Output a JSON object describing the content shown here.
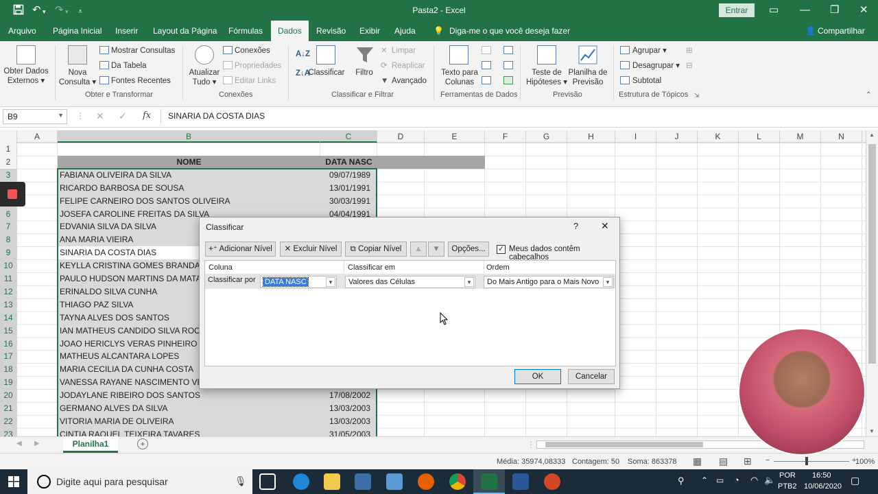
{
  "titlebar": {
    "save_icon": "save-icon",
    "title": "Pasta2  -  Excel",
    "signin": "Entrar"
  },
  "menubar": {
    "tabs": [
      "Arquivo",
      "Página Inicial",
      "Inserir",
      "Layout da Página",
      "Fórmulas",
      "Dados",
      "Revisão",
      "Exibir",
      "Ajuda"
    ],
    "tell_me": "Diga-me o que você deseja fazer",
    "share": "Compartilhar"
  },
  "ribbon": {
    "get_data": {
      "btn1": "Obter Dados",
      "btn1b": "Externos",
      "btn2": "Nova",
      "btn2b": "Consulta",
      "mostrar": "Mostrar Consultas",
      "tabela": "Da Tabela",
      "fontes": "Fontes Recentes",
      "group": "Obter e Transformar"
    },
    "connections": {
      "refresh": "Atualizar",
      "refreshb": "Tudo",
      "conexoes": "Conexões",
      "propriedades": "Propriedades",
      "editar": "Editar Links",
      "group": "Conexões"
    },
    "sort": {
      "classificar": "Classificar",
      "filtro": "Filtro",
      "limpar": "Limpar",
      "reaplicar": "Reaplicar",
      "avancado": "Avançado",
      "group": "Classificar e Filtrar"
    },
    "tools": {
      "texto": "Texto para",
      "textob": "Colunas",
      "group": "Ferramentas de Dados"
    },
    "forecast": {
      "teste": "Teste de",
      "testeb": "Hipóteses",
      "planilha": "Planilha de",
      "planilhab": "Previsão",
      "group": "Previsão"
    },
    "outline": {
      "agrupar": "Agrupar",
      "desagrupar": "Desagrupar",
      "subtotal": "Subtotal",
      "group": "Estrutura de Tópicos"
    }
  },
  "formula_bar": {
    "name_box": "B9",
    "content": "SINARIA DA COSTA DIAS"
  },
  "columns": [
    "A",
    "B",
    "C",
    "D",
    "E",
    "F",
    "G",
    "H",
    "I",
    "J",
    "K",
    "L",
    "M",
    "N"
  ],
  "rows": [
    "1",
    "2",
    "3",
    "4",
    "5",
    "6",
    "7",
    "8",
    "9",
    "10",
    "11",
    "12",
    "13",
    "14",
    "15",
    "16",
    "17",
    "18",
    "19",
    "20",
    "21",
    "22",
    "23"
  ],
  "table": {
    "header_name": "NOME",
    "header_date": "DATA NASC",
    "names": [
      "FABIANA OLIVEIRA DA SILVA",
      "RICARDO BARBOSA DE SOUSA",
      "FELIPE CARNEIRO DOS SANTOS OLIVEIRA",
      "JOSEFA CAROLINE FREITAS DA SILVA",
      "EDVANIA SILVA DA SILVA",
      "ANA MARIA VIEIRA",
      "SINARIA DA COSTA DIAS",
      "KEYLLA CRISTINA GOMES BRANDAO",
      "PAULO HUDSON MARTINS DA MATA",
      "ERINALDO SILVA CUNHA",
      "THIAGO PAZ SILVA",
      "TAYNA ALVES DOS SANTOS",
      "IAN MATHEUS CANDIDO SILVA ROCH",
      "JOAO HERICLYS VERAS PINHEIRO",
      "MATHEUS ALCANTARA LOPES",
      "MARIA CECILIA DA CUNHA COSTA",
      "VANESSA RAYANE NASCIMENTO VE",
      "JODAYLANE RIBEIRO DOS SANTOS",
      "GERMANO ALVES DA SILVA",
      "VITORIA MARIA DE OLIVEIRA",
      "CINTIA RAQUEL TEIXEIRA TAVARES"
    ],
    "dates": [
      "09/07/1989",
      "13/01/1991",
      "30/03/1991",
      "04/04/1991",
      "",
      "",
      "",
      "",
      "",
      "",
      "",
      "",
      "",
      "",
      "",
      "",
      "",
      "17/08/2002",
      "13/03/2003",
      "13/03/2003",
      "31/05/2003"
    ]
  },
  "sheet_tab": "Planilha1",
  "status": {
    "media": "Média: 35974,08333",
    "contagem": "Contagem: 50",
    "soma": "Soma: 863378",
    "zoom": "100%"
  },
  "dialog": {
    "title": "Classificar",
    "help": "?",
    "close": "✕",
    "add_level": "Adicionar Nível",
    "delete_level": "Excluir Nível",
    "copy_level": "Copiar Nível",
    "options": "Opções...",
    "headers_checkbox": "Meus dados contêm cabeçalhos",
    "col_header": "Coluna",
    "sort_on_header": "Classificar em",
    "order_header": "Ordem",
    "sort_by_label": "Classificar por",
    "column_value": "DATA NASC",
    "sort_on_value": "Valores das Células",
    "order_value": "Do Mais Antigo para o Mais Novo",
    "ok": "OK",
    "cancel": "Cancelar"
  },
  "taskbar": {
    "search_placeholder": "Digite aqui para pesquisar",
    "lang1": "POR",
    "lang2": "PTB2",
    "time": "16:50",
    "date": "10/06/2020"
  }
}
